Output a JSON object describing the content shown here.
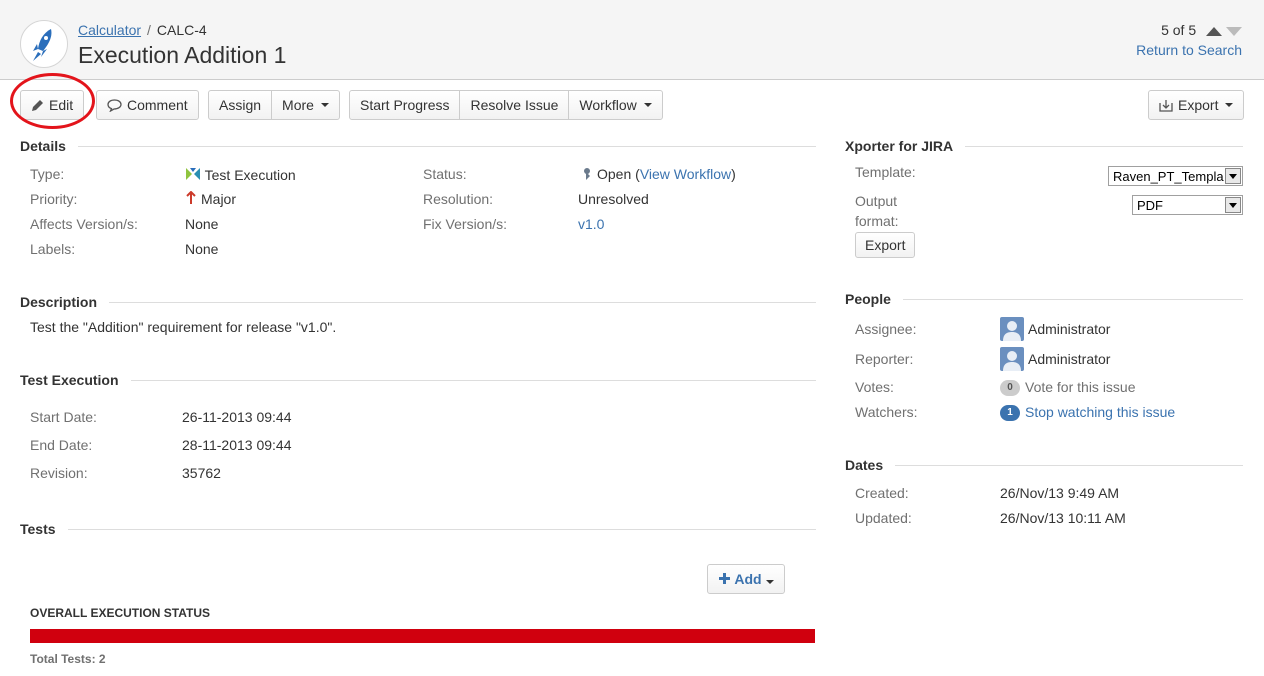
{
  "breadcrumb": {
    "project": "Calculator",
    "separator": "/",
    "issue_key": "CALC-4"
  },
  "issue_title": "Execution Addition 1",
  "pager": {
    "position": "5 of 5",
    "return_label": "Return to Search"
  },
  "toolbar": {
    "edit": "Edit",
    "comment": "Comment",
    "assign": "Assign",
    "more": "More",
    "start_progress": "Start Progress",
    "resolve_issue": "Resolve Issue",
    "workflow": "Workflow",
    "export": "Export"
  },
  "details": {
    "heading": "Details",
    "type_label": "Type:",
    "type_value": "Test Execution",
    "priority_label": "Priority:",
    "priority_value": "Major",
    "affects_label": "Affects Version/s:",
    "affects_value": "None",
    "labels_label": "Labels:",
    "labels_value": "None",
    "status_label": "Status:",
    "status_value": "Open",
    "status_open_paren": "(",
    "view_workflow": "View Workflow",
    "status_close_paren": ")",
    "resolution_label": "Resolution:",
    "resolution_value": "Unresolved",
    "fix_label": "Fix Version/s:",
    "fix_value": "v1.0"
  },
  "description": {
    "heading": "Description",
    "text": "Test the \"Addition\" requirement for release \"v1.0\"."
  },
  "test_execution": {
    "heading": "Test Execution",
    "start_label": "Start Date:",
    "start_value": "26-11-2013 09:44",
    "end_label": "End Date:",
    "end_value": "28-11-2013 09:44",
    "revision_label": "Revision:",
    "revision_value": "35762"
  },
  "tests": {
    "heading": "Tests",
    "add_label": "Add",
    "overall_status_label": "OVERALL EXECUTION STATUS",
    "overall_status_fraction_failed": 1.0,
    "total_tests": "Total Tests: 2"
  },
  "xporter": {
    "heading": "Xporter for JIRA",
    "template_label": "Template:",
    "template_value": "Raven_PT_Templa",
    "output_label_1": "Output",
    "output_label_2": "format:",
    "output_value": "PDF",
    "export_button": "Export"
  },
  "people": {
    "heading": "People",
    "assignee_label": "Assignee:",
    "assignee_value": "Administrator",
    "reporter_label": "Reporter:",
    "reporter_value": "Administrator",
    "votes_label": "Votes:",
    "votes_count": "0",
    "votes_link": "Vote for this issue",
    "watchers_label": "Watchers:",
    "watchers_count": "1",
    "watchers_link": "Stop watching this issue"
  },
  "dates": {
    "heading": "Dates",
    "created_label": "Created:",
    "created_value": "26/Nov/13 9:49 AM",
    "updated_label": "Updated:",
    "updated_value": "26/Nov/13 10:11 AM"
  },
  "colors": {
    "link": "#3b73af",
    "status_bar_fail": "#d0000e",
    "highlight_circle": "#e3141b"
  },
  "icons": [
    "rocket-icon",
    "pencil-icon",
    "speech-bubble-icon",
    "export-icon",
    "test-execution-icon",
    "priority-major-icon",
    "status-open-icon",
    "plus-icon",
    "user-avatar-icon"
  ]
}
